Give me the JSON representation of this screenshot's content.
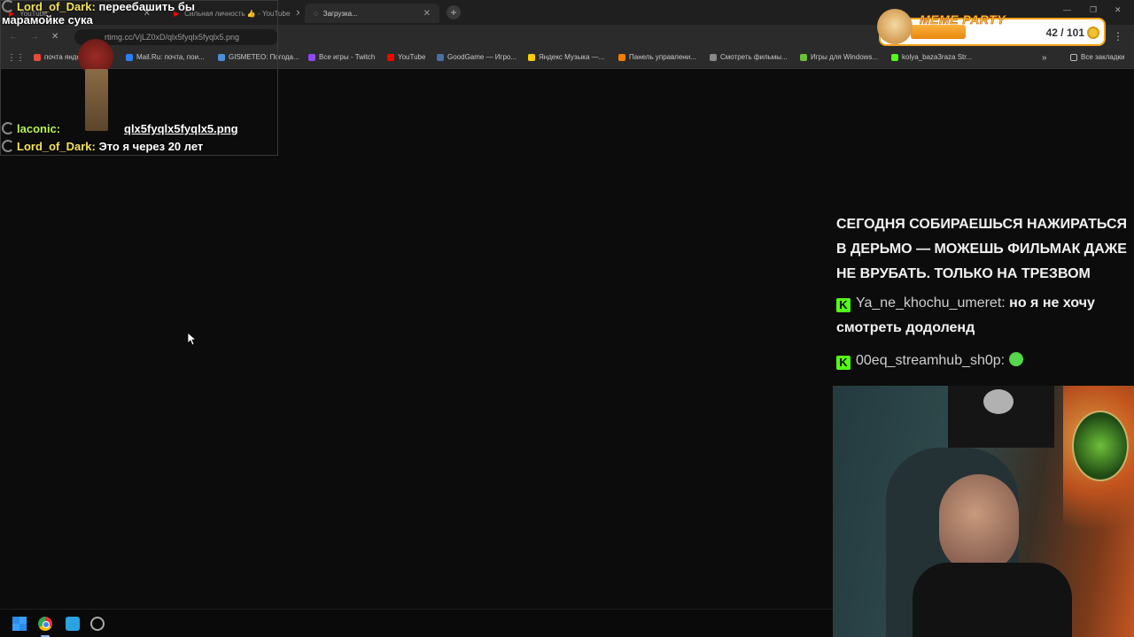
{
  "browser": {
    "tabs": [
      {
        "label": "YouTube",
        "active": false
      },
      {
        "label": "Сильная личность 👍 - YouTube",
        "active": false
      },
      {
        "label": "Загрузка...",
        "active": true
      }
    ],
    "new_tab_icon": "plus-icon",
    "url": "rtimg.cc/VjLZ0xD/qlx5fyqlx5fyqlx5.png",
    "bookmarks": [
      {
        "label": "почта яндекс",
        "icon_color": "#e84b3c"
      },
      {
        "label": "Mail.Ru: почта, пои...",
        "icon_color": "#2d7cf6"
      },
      {
        "label": "GISMETEO: Погода...",
        "icon_color": "#4a90d9"
      },
      {
        "label": "Все игры - Twitch",
        "icon_color": "#9146ff"
      },
      {
        "label": "YouTube",
        "icon_color": "#ff0000"
      },
      {
        "label": "GoodGame — Игро...",
        "icon_color": "#4a6fa5"
      },
      {
        "label": "Яндекс Музыка —...",
        "icon_color": "#ffcc00"
      },
      {
        "label": "Панель управлени...",
        "icon_color": "#f57c00"
      },
      {
        "label": "Смотреть фильмы...",
        "icon_color": "#888888"
      },
      {
        "label": "Игры для Windows...",
        "icon_color": "#6bbf3a"
      },
      {
        "label": "kolya_baza3raza Str...",
        "icon_color": "#53fc18"
      }
    ],
    "more_bookmarks": "»",
    "all_bookmarks": "Все закладки"
  },
  "meme_party": {
    "title": "MEME PARTY",
    "score": "42 / 101"
  },
  "overlay_chat": [
    {
      "nick": "Lord_of_Dark:",
      "text": "переебашить бы",
      "text2": "марамойке сука"
    },
    {
      "nick": "laconic:",
      "text": "qlx5fyqlx5fyqlx5.png"
    },
    {
      "nick": "Lord_of_Dark:",
      "text": "Это я через 20 лет"
    }
  ],
  "stream_chat": {
    "prev_message": "СЕГОДНЯ СОБИРАЕШЬСЯ НАЖИРАТЬСЯ В ДЕРЬМО — МОЖЕШЬ ФИЛЬМАК ДАЖЕ НЕ ВРУБАТЬ. ТОЛЬКО НА ТРЕЗВОМ",
    "messages": [
      {
        "nick": "Ya_ne_khochu_umeret:",
        "text": "но я не хочу смотреть додоленд"
      },
      {
        "nick": "00eq_streamhub_sh0p:",
        "text": ""
      }
    ]
  },
  "colors": {
    "accent_kick": "#53fc18",
    "nick_yellow": "#f5e25f",
    "meme_orange": "#f2a21a"
  }
}
